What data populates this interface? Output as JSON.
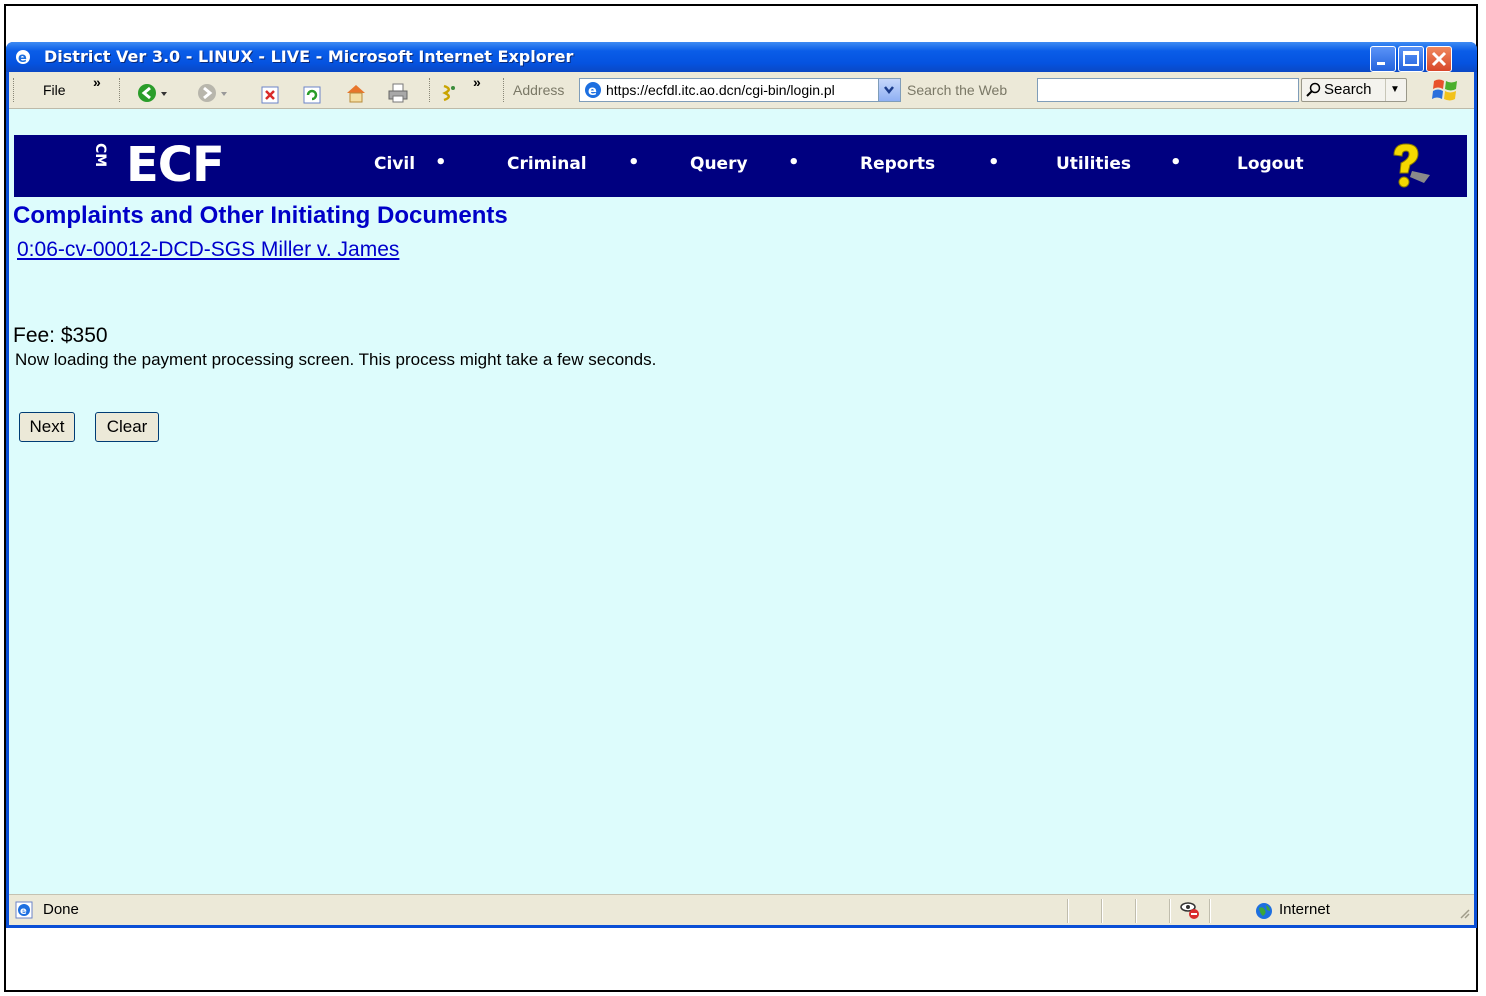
{
  "window": {
    "title": "District Ver 3.0 - LINUX - LIVE - Microsoft Internet Explorer"
  },
  "toolbar": {
    "file_menu": "File",
    "chevron_1": "»",
    "chevron_2": "»",
    "address_label": "Address",
    "address_url": "https://ecfdl.itc.ao.dcn/cgi-bin/login.pl",
    "search_label": "Search the Web",
    "search_value": "",
    "search_button": "Search"
  },
  "navbar": {
    "logo_cm": "CM",
    "logo_ecf": "ECF",
    "items": [
      "Civil",
      "Criminal",
      "Query",
      "Reports",
      "Utilities",
      "Logout"
    ],
    "separator": "•"
  },
  "main": {
    "page_title": "Complaints and Other Initiating Documents",
    "case_link": "0:06-cv-00012-DCD-SGS Miller v. James",
    "fee": "Fee: $350",
    "loading_message": "Now loading the payment processing screen. This process might take a few seconds.",
    "next_button": "Next",
    "clear_button": "Clear"
  },
  "statusbar": {
    "status": "Done",
    "zone": "Internet"
  },
  "colors": {
    "page_background": "#ddfcfc",
    "navbar_background": "#000080",
    "title_color": "#0000c8",
    "link_color": "#0000cc"
  }
}
